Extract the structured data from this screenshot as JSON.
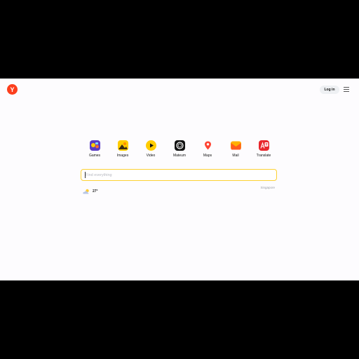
{
  "header": {
    "logo_letter": "Y",
    "login_label": "Log in",
    "menu_icon": "hamburger-icon"
  },
  "services": [
    {
      "label": "Games",
      "icon": "games-icon"
    },
    {
      "label": "Images",
      "icon": "images-icon"
    },
    {
      "label": "Video",
      "icon": "video-icon"
    },
    {
      "label": "Mateum",
      "icon": "mateum-icon"
    },
    {
      "label": "Maps",
      "icon": "maps-icon"
    },
    {
      "label": "Mail",
      "icon": "mail-icon"
    },
    {
      "label": "Translate",
      "icon": "translate-icon"
    }
  ],
  "search": {
    "placeholder": "Find everything",
    "value": ""
  },
  "weather": {
    "temperature": "27°",
    "icon": "cloud-sun-icon"
  },
  "location": {
    "city": "Singapore"
  },
  "colors": {
    "brand_red": "#fc3f1d",
    "search_border": "#fcd133",
    "page_bg": "#fdfcfe"
  }
}
